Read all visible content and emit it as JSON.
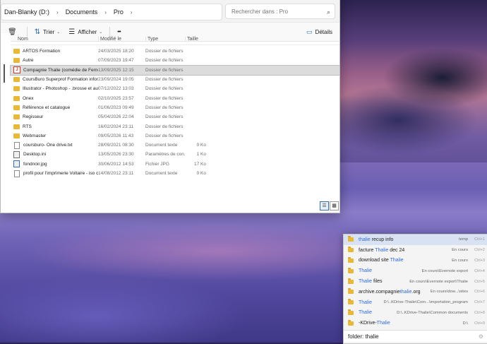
{
  "explorer": {
    "breadcrumbs": [
      "Dan-Blanky (D:)",
      "Documents",
      "Pro"
    ],
    "search_placeholder": "Rechercher dans : Pro",
    "toolbar": {
      "sort_label": "Trier",
      "view_label": "Afficher",
      "more_label": "•••",
      "details_label": "Détails"
    },
    "columns": {
      "name": "Nom",
      "modified": "Modifié le",
      "type": "Type",
      "size": "Taille"
    },
    "rows": [
      {
        "icon": "folder",
        "name": "ARTOS Formation",
        "modified": "24/03/2025 18:20",
        "type": "Dossier de fichiers",
        "size": ""
      },
      {
        "icon": "folder",
        "name": "Autre",
        "modified": "07/09/2023 19:47",
        "type": "Dossier de fichiers",
        "size": ""
      },
      {
        "icon": "special",
        "name": "Compagnie Thalie (comédie de Ferney) ...",
        "modified": "13/09/2025 12:15",
        "type": "Dossier de fichiers",
        "size": "",
        "selected": true
      },
      {
        "icon": "folder",
        "name": "CoursBuro Superprof  Formation informa...",
        "modified": "23/09/2024 19:05",
        "type": "Dossier de fichiers",
        "size": ""
      },
      {
        "icon": "folder",
        "name": "Illustrator - Photoshop - .brosse et autres",
        "modified": "07/12/2022 13:03",
        "type": "Dossier de fichiers",
        "size": ""
      },
      {
        "icon": "folder",
        "name": "Onex",
        "modified": "02/10/2025 23:57",
        "type": "Dossier de fichiers",
        "size": ""
      },
      {
        "icon": "folder",
        "name": "Référence et catalogue",
        "modified": "01/06/2023 09:49",
        "type": "Dossier de fichiers",
        "size": ""
      },
      {
        "icon": "folder",
        "name": "Regisseur",
        "modified": "05/04/2026 22:04",
        "type": "Dossier de fichiers",
        "size": ""
      },
      {
        "icon": "folder",
        "name": "RTS",
        "modified": "16/02/2024 23:11",
        "type": "Dossier de fichiers",
        "size": ""
      },
      {
        "icon": "folder",
        "name": "Webmaster",
        "modified": "09/05/2026 11:43",
        "type": "Dossier de fichiers",
        "size": ""
      },
      {
        "icon": "doc",
        "name": "coursburo- One drive.txt",
        "modified": "28/09/2021 08:30",
        "type": "Document texte",
        "size": "0 Ko"
      },
      {
        "icon": "ini",
        "name": "Desktop.ini",
        "modified": "13/05/2026 23:30",
        "type": "Paramètres de con...",
        "size": "1 Ko"
      },
      {
        "icon": "img",
        "name": "fondnoir.jpg",
        "modified": "30/06/2012 14:53",
        "type": "Fichier JPG",
        "size": "17 Ko"
      },
      {
        "icon": "doc",
        "name": "profil pour l'imprimerie Voltaire - iso coat...",
        "modified": "14/08/2012 23:11",
        "type": "Document texte",
        "size": "0 Ko"
      }
    ]
  },
  "launcher": {
    "results": [
      {
        "pre": "",
        "hl": "thalie",
        "post": " recup info",
        "path": "temp",
        "key": "Ctrl+1",
        "active": true
      },
      {
        "pre": "facture ",
        "hl": "Thalie",
        "post": " dec 24",
        "path": "En cours",
        "key": "Ctrl+2"
      },
      {
        "pre": "download site ",
        "hl": "Thalie",
        "post": "",
        "path": "En cours",
        "key": "Ctrl+3"
      },
      {
        "pre": "",
        "hl": "Thalie",
        "post": "",
        "path": "En cours\\Evernote export",
        "key": "Ctrl+4"
      },
      {
        "pre": "",
        "hl": "Thalie",
        "post": " files",
        "path": "En cours\\Evernote export\\Thalie",
        "key": "Ctrl+5"
      },
      {
        "pre": "archive.compagnie",
        "hl": "thalie",
        "post": ".org",
        "path": "En cours\\dow...\\sites",
        "key": "Ctrl+6"
      },
      {
        "pre": "",
        "hl": "Thalie",
        "post": "",
        "path": "D:\\..KDrive-Thalie\\Com...\\importation_program",
        "key": "Ctrl+7"
      },
      {
        "pre": "",
        "hl": "Thalie",
        "post": "",
        "path": "D:\\..KDrive-Thalie\\Common documents",
        "key": "Ctrl+8"
      },
      {
        "pre": "-KDrive-",
        "hl": "Thalie",
        "post": "",
        "path": "D:\\",
        "key": "Ctrl+9"
      }
    ],
    "query": "folder: thalie"
  }
}
